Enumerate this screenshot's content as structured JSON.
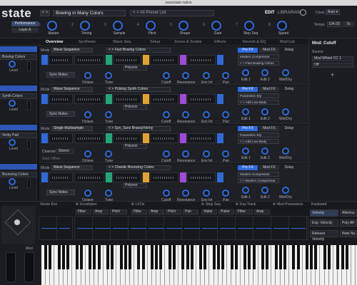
{
  "window_title": "wavestate native",
  "app": {
    "logo": "state"
  },
  "header": {
    "nav_arrows": "< >",
    "preset_name": "Bowing in Many Colors",
    "preset_list": "< > All Preset List",
    "edit": "EDIT",
    "librarian": "LIBRARIAN",
    "clock_label": "Clock",
    "clock_value": "Auto ▾",
    "performance": "Performance",
    "layer": "Layer A",
    "tempo_label": "Tempo",
    "tempo_value": "104.00",
    "tempo_btn": "Ts"
  },
  "macros": [
    {
      "num": "1",
      "label": "Master"
    },
    {
      "num": "2",
      "label": "Timing"
    },
    {
      "num": "3",
      "label": "Sample"
    },
    {
      "num": "4",
      "label": "Pitch"
    },
    {
      "num": "5",
      "label": "Shape"
    },
    {
      "num": "6",
      "label": "Gate"
    },
    {
      "num": "7",
      "label": "Step Seq"
    },
    {
      "num": "8",
      "label": "Speed"
    }
  ],
  "tabs": [
    "Overview",
    "Synthesis",
    "Wave Seq",
    "Setup",
    "Zones & Scales",
    "Effects",
    "Reverb & EQ",
    "Mod List"
  ],
  "layers": [
    {
      "name": "Bowing Colors",
      "level": "Level"
    },
    {
      "name": "Synth Colors",
      "level": "Level"
    },
    {
      "name": "Verby Pad",
      "level": "Level"
    },
    {
      "name": "Bouncing Colors",
      "level": "Level"
    }
  ],
  "rows": [
    {
      "mode": "Mode",
      "mode_value": "Wave Sequence",
      "wave": "< > Fast Bowing Colors",
      "sync": "Sync Notes",
      "poly": "Polyvox",
      "fx_sel1": "Modern Compressor",
      "fx_sel2": "< > Fast Bowing Colors"
    },
    {
      "mode": "Mode",
      "mode_value": "Wave Sequence",
      "wave": "< > Pulsing Synth Colors",
      "sync": "Sync Notes",
      "poly": "Polyvox",
      "fx_sel1": "Parametric EQ",
      "fx_sel2": "< > Add Low Body"
    },
    {
      "mode": "Mode",
      "mode_value": "Single Multisample",
      "wave": "< > Syn_Sunz Brassy/Verby",
      "sync": "Channel",
      "poly": "Polyvox",
      "fx_sel1": "Parametric EQ",
      "fx_sel2": "< > Add Low Body"
    },
    {
      "mode": "Mode",
      "mode_value": "Wave Sequence",
      "wave": "< > Chaotic Bouncing Colors",
      "sync": "Sync Notes",
      "poly": "Polyvox",
      "fx_sel1": "Modern Compressor",
      "fx_sel2": "< > Modern Compressor"
    }
  ],
  "row_labels": {
    "octave": "Octave",
    "tune": "Tune",
    "cutoff": "Cutoff",
    "resonance": "Resonance",
    "env_int": "Env Int",
    "pan": "Pan",
    "edit1": "Edit 1",
    "edit2": "Edit 2",
    "wet": "Wet/Dry",
    "pre_fx": "Pre FX",
    "mod_fx": "Mod FX",
    "delay": "Delay"
  },
  "channel": {
    "label": "Channel",
    "value": "Stereo",
    "start_offset": "Start Offset"
  },
  "right_panel": {
    "title": "Mod: Cutoff",
    "source": "Source",
    "source_value": "Mod Wheel CC 1",
    "off": "Off",
    "plus": "+"
  },
  "bottom": {
    "vector_env": "Vector Env",
    "envelopes": "A: Envelopes",
    "lfos": "A: LFOs",
    "step_seq": "A: Step Seq",
    "key_track": "A: Key Track",
    "mod_processors": "A: Mod Processors",
    "keyboard": "Keyboard",
    "env_cells": [
      "Filter",
      "Amp",
      "Pitch"
    ],
    "lfo_cells": [
      "Filter",
      "Amp",
      "Pitch",
      "Pan"
    ],
    "step_cells": [
      "Value",
      "Pulse"
    ],
    "key_cells": [
      "Filter",
      "Amp"
    ],
    "kb_items": [
      {
        "label": "Velocity",
        "right": "Aftertou"
      },
      {
        "label": "Exp. Velocity",
        "right": "Poly Aft"
      },
      {
        "label": "Release Velocity",
        "right": "Note Nu"
      }
    ]
  },
  "wheels": {
    "mod_label": "Mod"
  },
  "colors": {
    "accent": "#2f6ad8",
    "bg": "#111317",
    "panel": "#1e2025"
  }
}
